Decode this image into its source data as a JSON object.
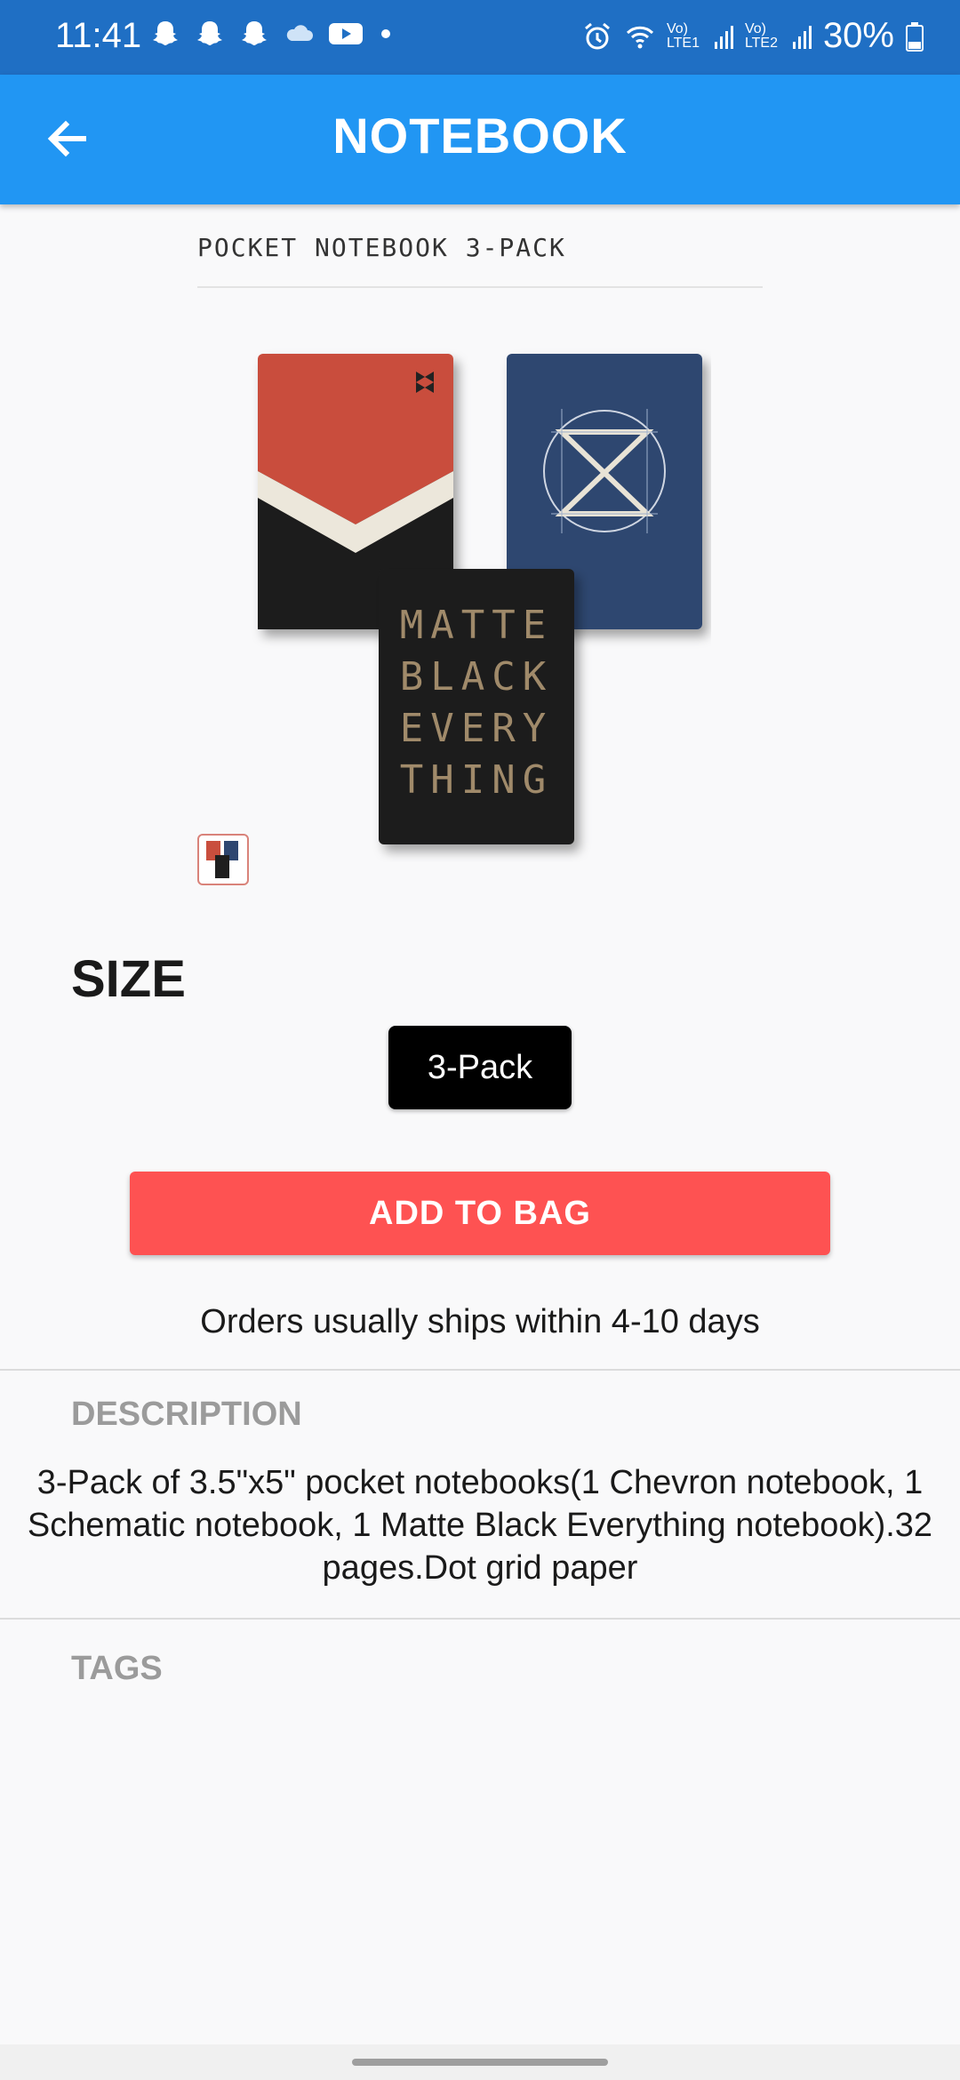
{
  "status_bar": {
    "time": "11:41",
    "battery": "30%",
    "left_icons": [
      "snapchat-icon",
      "snapchat-icon",
      "snapchat-icon",
      "cloud-icon",
      "youtube-icon",
      "dot-icon"
    ],
    "right_icons": [
      "alarm-icon",
      "wifi-icon",
      "signal-lte1-icon",
      "signal-lte2-icon",
      "battery-icon"
    ],
    "lte1": "Vo) LTE1",
    "lte2": "Vo) LTE2"
  },
  "app_bar": {
    "title": "NOTEBOOK",
    "back_icon": "arrow-back-icon",
    "color": "#2196f3"
  },
  "product": {
    "name": "POCKET NOTEBOOK 3-PACK",
    "image_alt_text": [
      "MATTE",
      "BLACK",
      "EVERY",
      "THING"
    ]
  },
  "size": {
    "label": "SIZE",
    "options": [
      "3-Pack"
    ],
    "selected": "3-Pack"
  },
  "actions": {
    "add_to_bag": "ADD TO BAG",
    "accent_color": "#fe5252"
  },
  "shipping_note": "Orders usually ships within 4-10 days",
  "description": {
    "label": "DESCRIPTION",
    "text": "3-Pack of 3.5\"x5\" pocket notebooks(1 Chevron notebook, 1 Schematic notebook, 1 Matte Black Everything notebook).32 pages.Dot grid paper"
  },
  "tags": {
    "label": "TAGS"
  }
}
